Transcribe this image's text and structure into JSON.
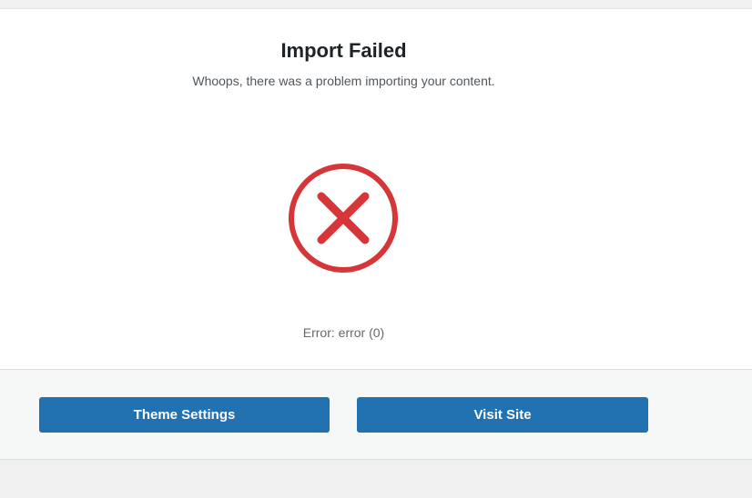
{
  "header": {
    "title": "Import Failed",
    "subtitle": "Whoops, there was a problem importing your content."
  },
  "status": {
    "icon": "error-circle-x-icon",
    "icon_color": "#d63638",
    "error_text": "Error: error (0)"
  },
  "actions": {
    "theme_settings_label": "Theme Settings",
    "visit_site_label": "Visit Site",
    "button_color": "#2271b1"
  }
}
